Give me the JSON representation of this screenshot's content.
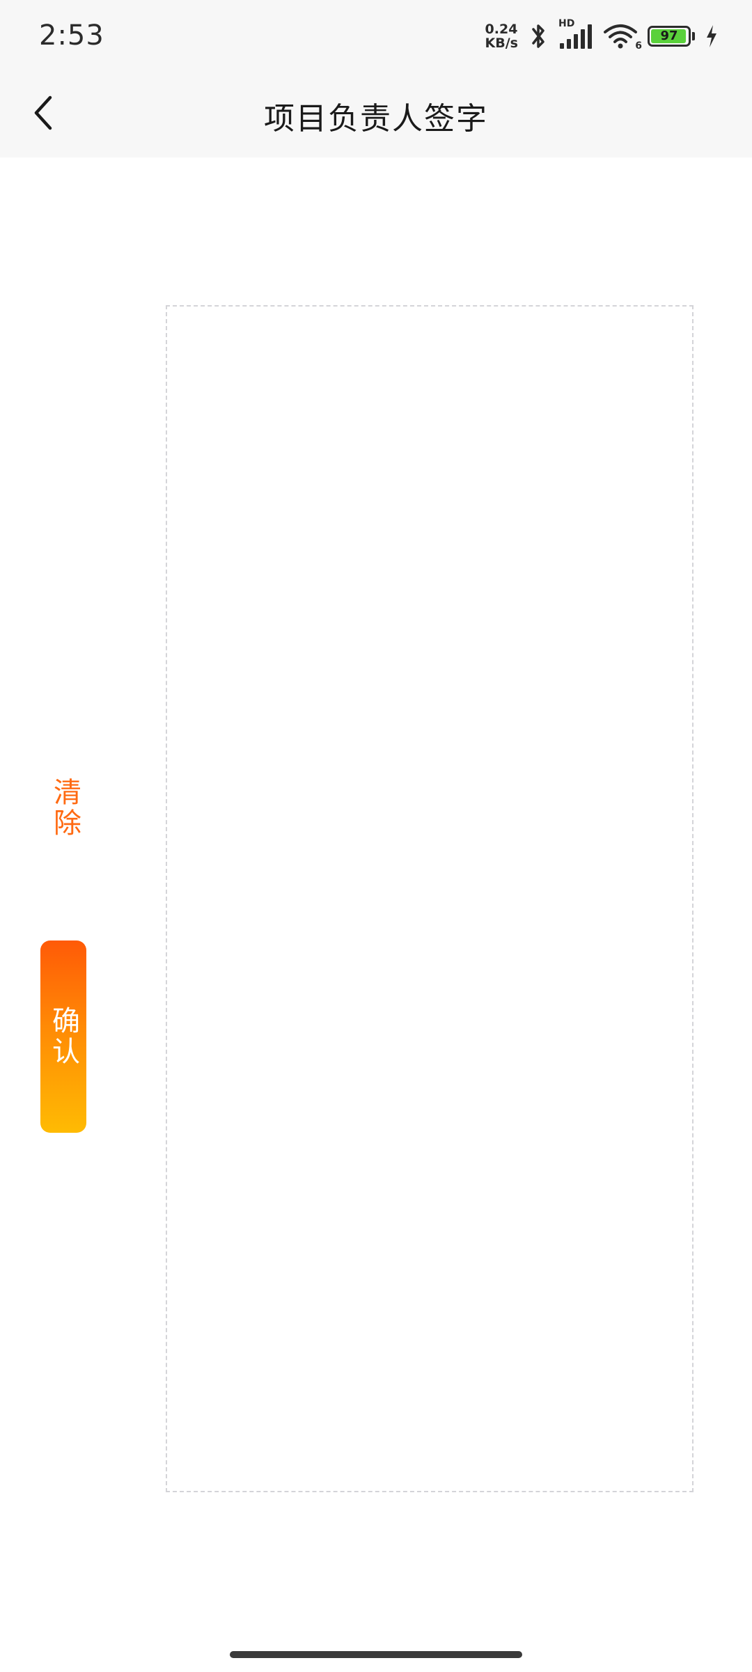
{
  "status_bar": {
    "time": "2:53",
    "net_speed_value": "0.24",
    "net_speed_unit": "KB/s",
    "signal_label": "HD",
    "wifi_label": "6",
    "battery_level": "97",
    "battery_color": "#5ad13b",
    "icons": [
      "bluetooth-icon",
      "signal-icon",
      "wifi-icon",
      "battery-icon",
      "charging-icon"
    ]
  },
  "header": {
    "title": "项目负责人签字",
    "back_icon": "chevron-left-icon"
  },
  "actions": {
    "clear_label": "清除",
    "confirm_label": "确认",
    "accent_color": "#ff6a12"
  }
}
